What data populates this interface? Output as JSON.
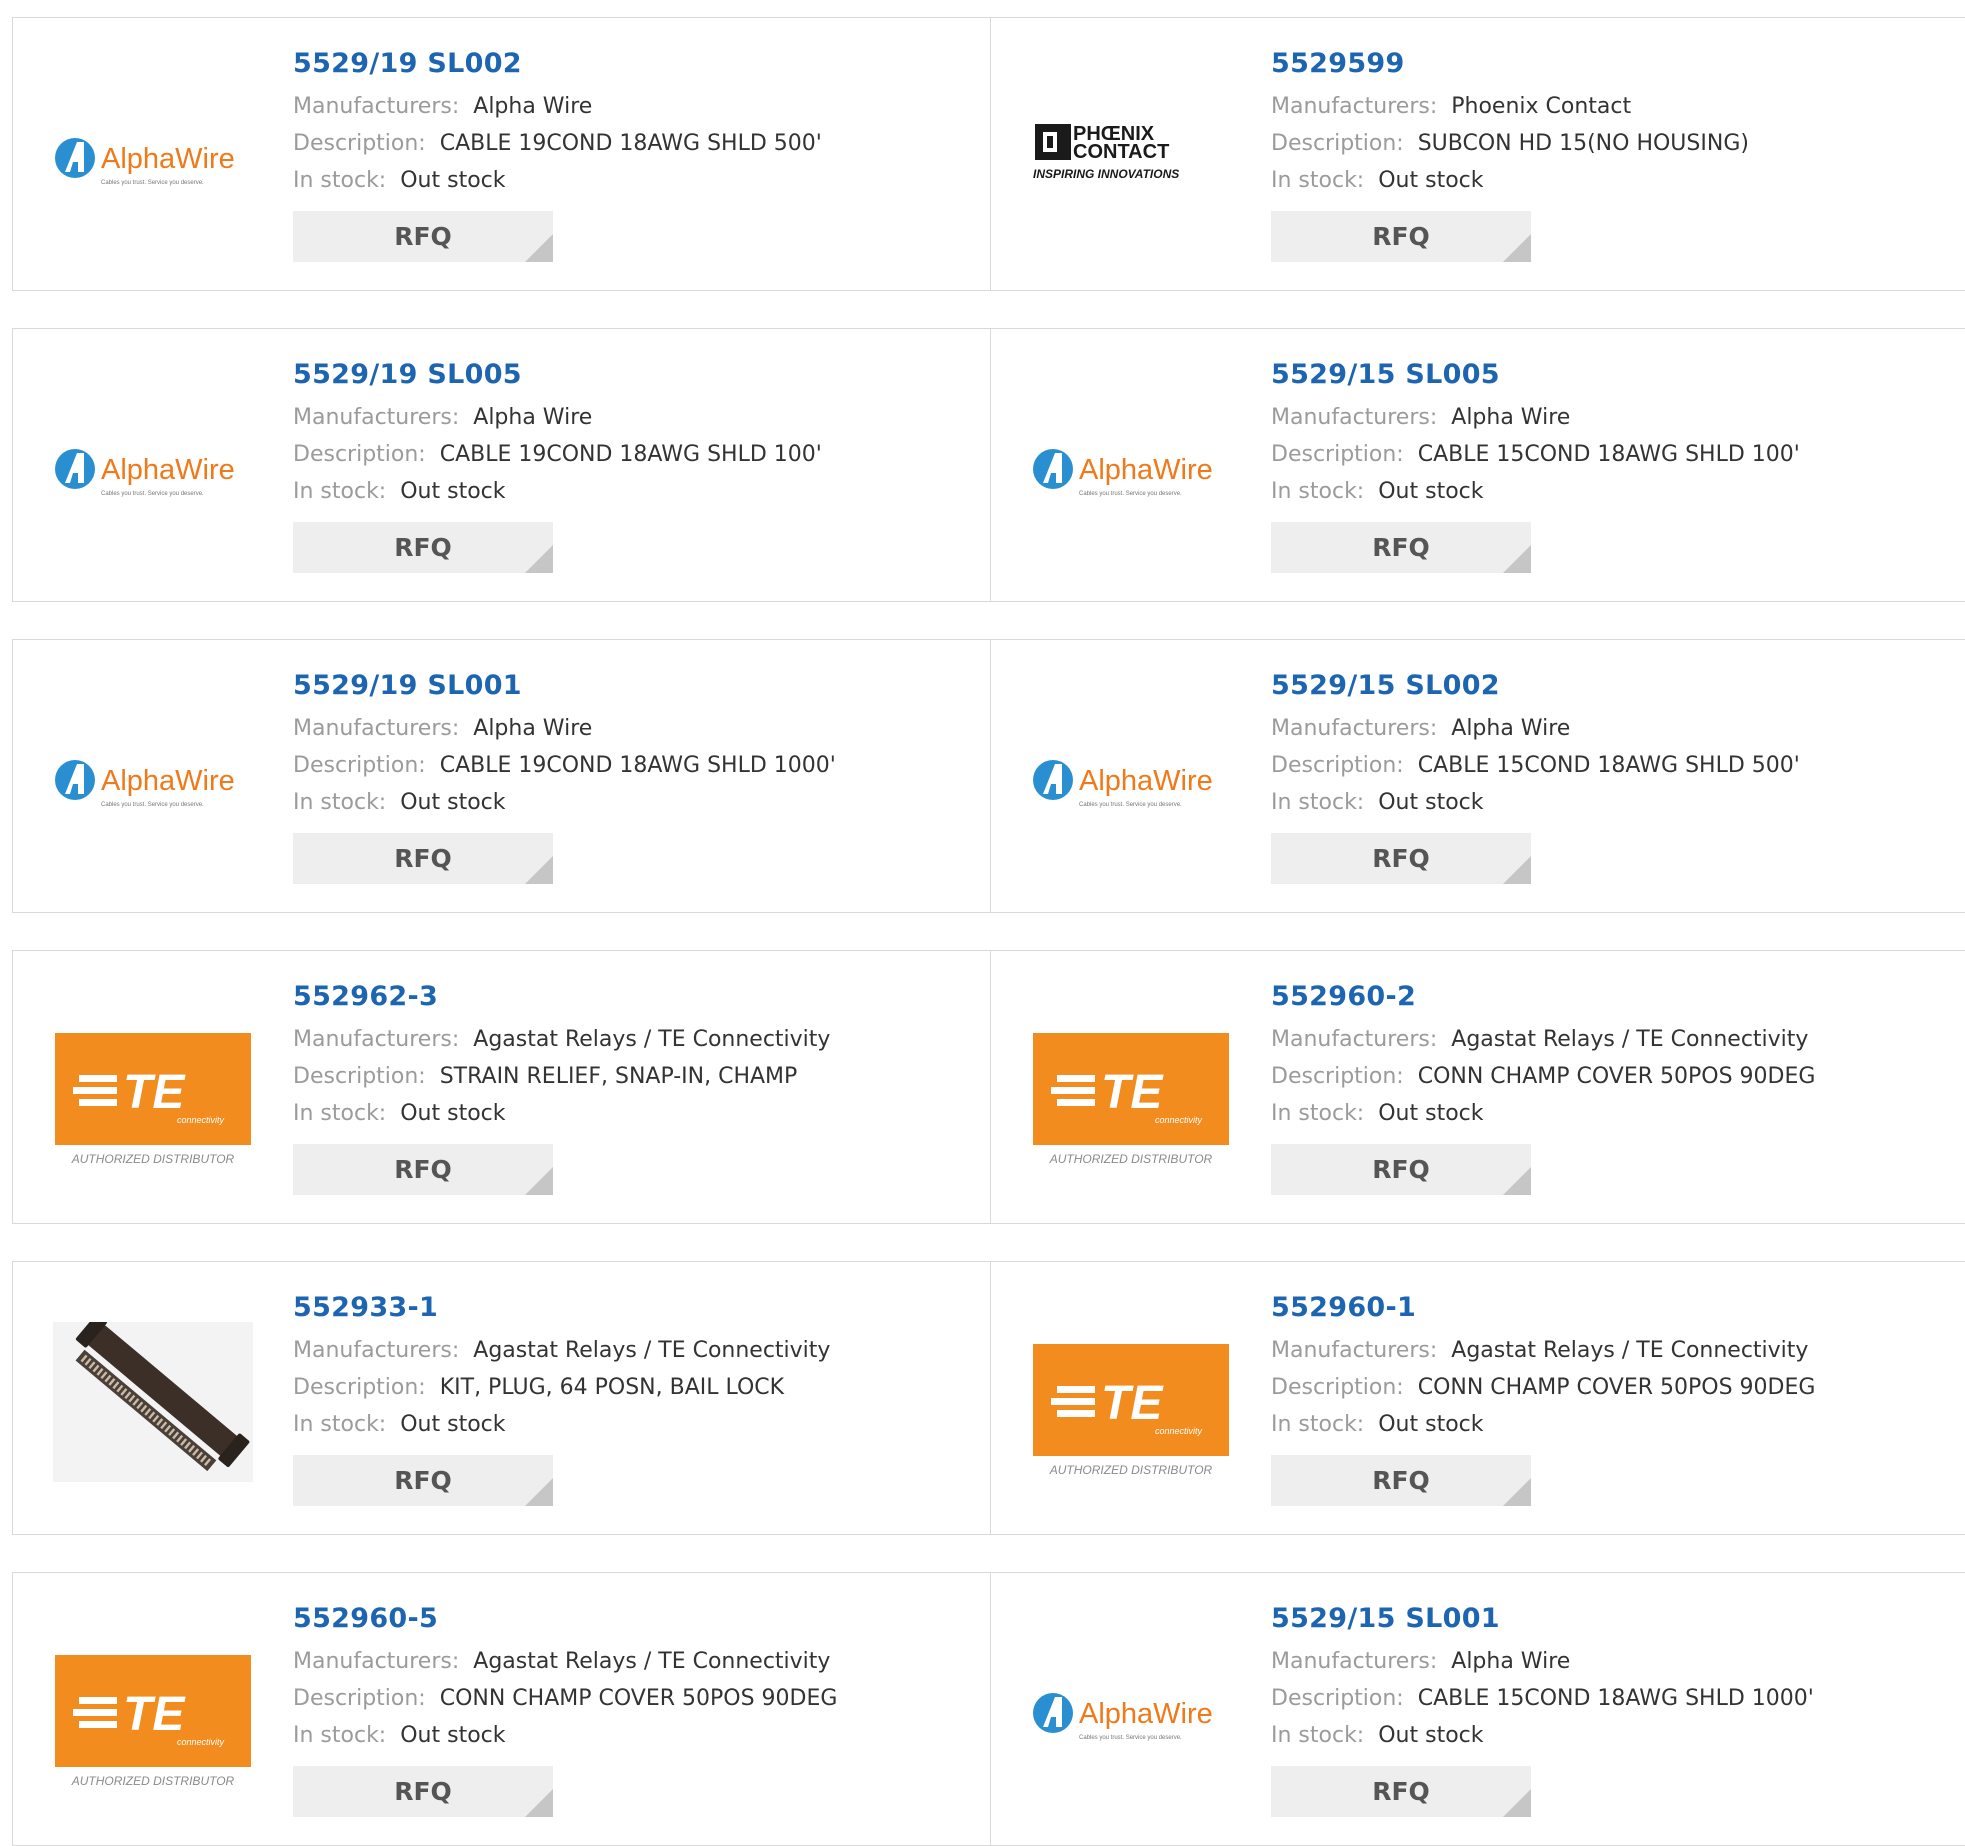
{
  "labels": {
    "manufacturers": "Manufacturers:",
    "description": "Description:",
    "in_stock": "In stock:",
    "rfq": "RFQ"
  },
  "logo_text": {
    "alphawire": "AlphaWire",
    "alphawire_tagline": "Cables you trust. Service you deserve.",
    "phoenix_line1": "PHŒNIX",
    "phoenix_line2": "CONTACT",
    "phoenix_tagline": "INSPIRING INNOVATIONS",
    "te_mark": "TE",
    "te_sub": "connectivity",
    "te_caption": "AUTHORIZED DISTRIBUTOR"
  },
  "colors": {
    "link": "#1d65b1",
    "te_orange": "#f28c1e",
    "alphawire_blue": "#2a8fd0",
    "alphawire_orange": "#f07a1a"
  },
  "rows": [
    [
      {
        "part": "5529/19 SL002",
        "manufacturer": "Alpha Wire",
        "description": "CABLE 19COND 18AWG SHLD 500'",
        "stock": "Out stock",
        "logo": "alphawire"
      },
      {
        "part": "5529599",
        "manufacturer": "Phoenix Contact",
        "description": "SUBCON HD 15(NO HOUSING)",
        "stock": "Out stock",
        "logo": "phoenix"
      }
    ],
    [
      {
        "part": "5529/19 SL005",
        "manufacturer": "Alpha Wire",
        "description": "CABLE 19COND 18AWG SHLD 100'",
        "stock": "Out stock",
        "logo": "alphawire"
      },
      {
        "part": "5529/15 SL005",
        "manufacturer": "Alpha Wire",
        "description": "CABLE 15COND 18AWG SHLD 100'",
        "stock": "Out stock",
        "logo": "alphawire"
      }
    ],
    [
      {
        "part": "5529/19 SL001",
        "manufacturer": "Alpha Wire",
        "description": "CABLE 19COND 18AWG SHLD 1000'",
        "stock": "Out stock",
        "logo": "alphawire"
      },
      {
        "part": "5529/15 SL002",
        "manufacturer": "Alpha Wire",
        "description": "CABLE 15COND 18AWG SHLD 500'",
        "stock": "Out stock",
        "logo": "alphawire"
      }
    ],
    [
      {
        "part": "552962-3",
        "manufacturer": "Agastat Relays / TE Connectivity",
        "description": "STRAIN RELIEF, SNAP-IN, CHAMP",
        "stock": "Out stock",
        "logo": "te"
      },
      {
        "part": "552960-2",
        "manufacturer": "Agastat Relays / TE Connectivity",
        "description": "CONN CHAMP COVER 50POS 90DEG",
        "stock": "Out stock",
        "logo": "te"
      }
    ],
    [
      {
        "part": "552933-1",
        "manufacturer": "Agastat Relays / TE Connectivity",
        "description": "KIT, PLUG, 64 POSN, BAIL LOCK",
        "stock": "Out stock",
        "logo": "connector-photo"
      },
      {
        "part": "552960-1",
        "manufacturer": "Agastat Relays / TE Connectivity",
        "description": "CONN CHAMP COVER 50POS 90DEG",
        "stock": "Out stock",
        "logo": "te"
      }
    ],
    [
      {
        "part": "552960-5",
        "manufacturer": "Agastat Relays / TE Connectivity",
        "description": "CONN CHAMP COVER 50POS 90DEG",
        "stock": "Out stock",
        "logo": "te"
      },
      {
        "part": "5529/15 SL001",
        "manufacturer": "Alpha Wire",
        "description": "CABLE 15COND 18AWG SHLD 1000'",
        "stock": "Out stock",
        "logo": "alphawire"
      }
    ]
  ]
}
